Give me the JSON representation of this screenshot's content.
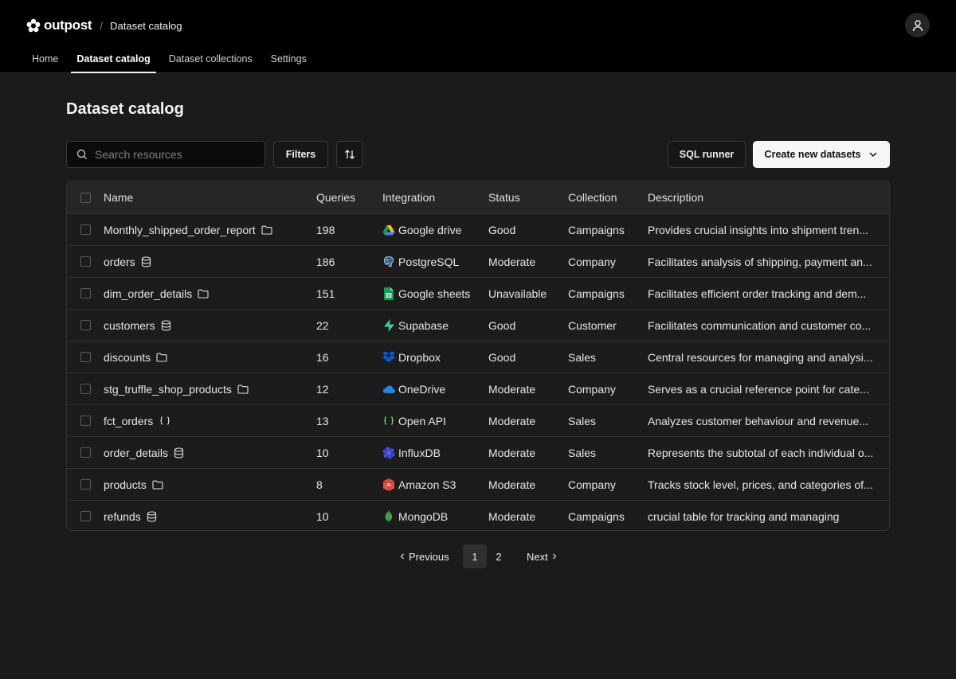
{
  "header": {
    "brand": "outpost",
    "separator": "/",
    "current_page": "Dataset catalog"
  },
  "nav": {
    "items": [
      {
        "label": "Home",
        "active": false
      },
      {
        "label": "Dataset catalog",
        "active": true
      },
      {
        "label": "Dataset collections",
        "active": false
      },
      {
        "label": "Settings",
        "active": false
      }
    ]
  },
  "main": {
    "title": "Dataset catalog",
    "search_placeholder": "Search resources",
    "filters_label": "Filters",
    "sql_runner_label": "SQL runner",
    "create_label": "Create new datasets"
  },
  "table": {
    "columns": [
      "Name",
      "Queries",
      "Integration",
      "Status",
      "Collection",
      "Description"
    ],
    "rows": [
      {
        "name": "Monthly_shipped_order_report",
        "type_icon": "folder-icon",
        "queries": "198",
        "integration": "Google drive",
        "integration_icon": "google-drive-icon",
        "status": "Good",
        "collection": "Campaigns",
        "description": "Provides crucial insights into shipment tren..."
      },
      {
        "name": "orders",
        "type_icon": "database-icon",
        "queries": "186",
        "integration": "PostgreSQL",
        "integration_icon": "postgresql-icon",
        "status": "Moderate",
        "collection": "Company",
        "description": "Facilitates analysis of shipping, payment an..."
      },
      {
        "name": "dim_order_details",
        "type_icon": "folder-icon",
        "queries": "151",
        "integration": "Google sheets",
        "integration_icon": "google-sheets-icon",
        "status": "Unavailable",
        "collection": "Campaigns",
        "description": "Facilitates efficient order tracking and dem..."
      },
      {
        "name": "customers",
        "type_icon": "database-icon",
        "queries": "22",
        "integration": "Supabase",
        "integration_icon": "supabase-icon",
        "status": "Good",
        "collection": "Customer",
        "description": "Facilitates communication and customer co..."
      },
      {
        "name": "discounts",
        "type_icon": "folder-icon",
        "queries": "16",
        "integration": "Dropbox",
        "integration_icon": "dropbox-icon",
        "status": "Good",
        "collection": "Sales",
        "description": "Central resources for managing and analysi..."
      },
      {
        "name": "stg_truffle_shop_products",
        "type_icon": "folder-icon",
        "queries": "12",
        "integration": "OneDrive",
        "integration_icon": "onedrive-icon",
        "status": "Moderate",
        "collection": "Company",
        "description": "Serves as a crucial reference point for cate..."
      },
      {
        "name": "fct_orders",
        "type_icon": "braces-icon",
        "queries": "13",
        "integration": "Open API",
        "integration_icon": "openapi-icon",
        "status": "Moderate",
        "collection": "Sales",
        "description": "Analyzes customer behaviour and revenue..."
      },
      {
        "name": "order_details",
        "type_icon": "database-icon",
        "queries": "10",
        "integration": "InfluxDB",
        "integration_icon": "influxdb-icon",
        "status": "Moderate",
        "collection": "Sales",
        "description": "Represents the subtotal of each individual o..."
      },
      {
        "name": "products",
        "type_icon": "folder-icon",
        "queries": "8",
        "integration": "Amazon S3",
        "integration_icon": "amazon-s3-icon",
        "status": "Moderate",
        "collection": "Company",
        "description": "Tracks stock level, prices, and categories of..."
      },
      {
        "name": "refunds",
        "type_icon": "database-icon",
        "queries": "10",
        "integration": "MongoDB",
        "integration_icon": "mongodb-icon",
        "status": "Moderate",
        "collection": "Campaigns",
        "description": "crucial table for tracking and managing"
      }
    ]
  },
  "pagination": {
    "prev_label": "Previous",
    "pages": [
      "1",
      "2"
    ],
    "current_page": "1",
    "next_label": "Next"
  }
}
